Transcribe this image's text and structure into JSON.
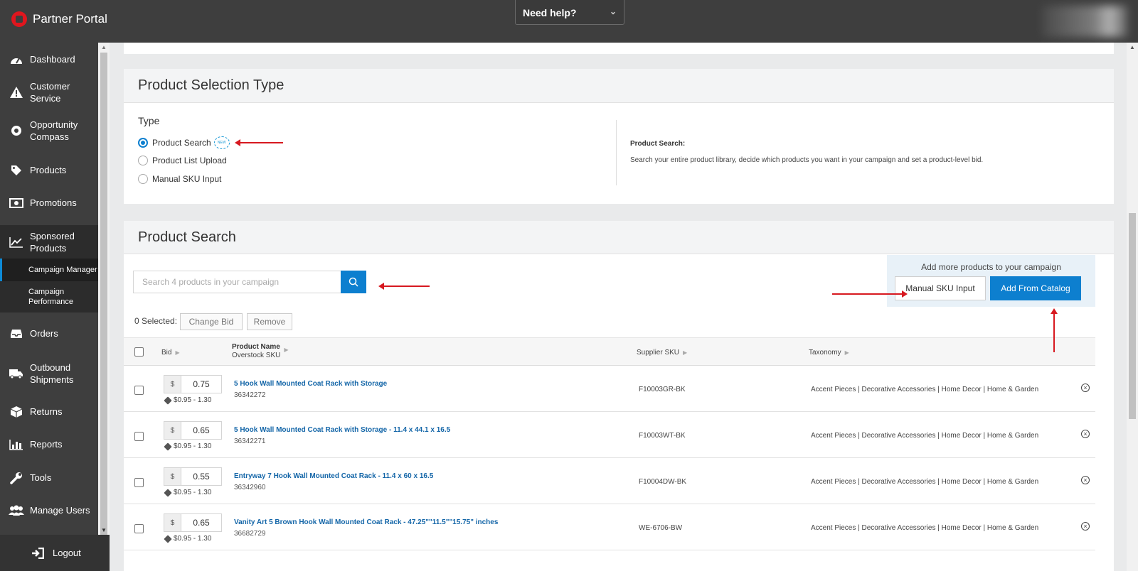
{
  "app": {
    "title": "Partner Portal",
    "help_label": "Need help?"
  },
  "sidebar": {
    "items": [
      {
        "label": "Dashboard",
        "icon": "dashboard-icon"
      },
      {
        "label": "Customer Service",
        "icon": "warning-icon"
      },
      {
        "label": "Opportunity Compass",
        "icon": "compass-icon"
      },
      {
        "label": "Products",
        "icon": "tag-icon"
      },
      {
        "label": "Promotions",
        "icon": "money-icon"
      },
      {
        "label": "Sponsored Products",
        "icon": "chart-line-icon"
      },
      {
        "label": "Orders",
        "icon": "inbox-icon"
      },
      {
        "label": "Outbound Shipments",
        "icon": "truck-icon"
      },
      {
        "label": "Returns",
        "icon": "box-icon"
      },
      {
        "label": "Reports",
        "icon": "bar-chart-icon"
      },
      {
        "label": "Tools",
        "icon": "wrench-icon"
      },
      {
        "label": "Manage Users",
        "icon": "users-icon"
      }
    ],
    "subitems": [
      {
        "label": "Campaign Manager",
        "selected": true
      },
      {
        "label": "Campaign Performance",
        "selected": false
      }
    ],
    "logout_label": "Logout"
  },
  "selection_type": {
    "title": "Product Selection Type",
    "type_label": "Type",
    "options": [
      {
        "label": "Product Search",
        "checked": true
      },
      {
        "label": "Product List Upload",
        "checked": false
      },
      {
        "label": "Manual SKU Input",
        "checked": false
      }
    ],
    "new_badge": "NEW",
    "description_title": "Product Search:",
    "description_text": "Search your entire product library, decide which products you want in your campaign and set a product-level bid."
  },
  "product_search": {
    "title": "Product Search",
    "search_placeholder": "Search 4 products in your campaign",
    "add_panel_title": "Add more products to your campaign",
    "manual_sku_button": "Manual SKU Input",
    "add_catalog_button": "Add From Catalog",
    "selected_label": "0 Selected:",
    "change_bid_button": "Change Bid",
    "remove_button": "Remove",
    "columns": {
      "bid": "Bid",
      "product_name": "Product Name",
      "overstock_sku": "Overstock SKU",
      "supplier_sku": "Supplier SKU",
      "taxonomy": "Taxonomy"
    },
    "currency": "$",
    "rows": [
      {
        "bid": "0.75",
        "range": "$0.95 - 1.30",
        "name": "5 Hook Wall Mounted Coat Rack with Storage",
        "sku": "36342272",
        "supplier_sku": "F10003GR-BK",
        "taxonomy": "Accent Pieces | Decorative Accessories | Home Decor | Home & Garden"
      },
      {
        "bid": "0.65",
        "range": "$0.95 - 1.30",
        "name": "5 Hook Wall Mounted Coat Rack with Storage - 11.4 x 44.1 x 16.5",
        "sku": "36342271",
        "supplier_sku": "F10003WT-BK",
        "taxonomy": "Accent Pieces | Decorative Accessories | Home Decor | Home & Garden"
      },
      {
        "bid": "0.55",
        "range": "$0.95 - 1.30",
        "name": "Entryway 7 Hook Wall Mounted Coat Rack - 11.4 x 60 x 16.5",
        "sku": "36342960",
        "supplier_sku": "F10004DW-BK",
        "taxonomy": "Accent Pieces | Decorative Accessories | Home Decor | Home & Garden"
      },
      {
        "bid": "0.65",
        "range": "$0.95 - 1.30",
        "name": "Vanity Art 5 Brown Hook Wall Mounted Coat Rack - 47.25\"\"11.5\"\"15.75\" inches",
        "sku": "36682729",
        "supplier_sku": "WE-6706-BW",
        "taxonomy": "Accent Pieces | Decorative Accessories | Home Decor | Home & Garden"
      }
    ]
  },
  "colors": {
    "accent": "#0d7fcf",
    "topbar": "#3e3e3e",
    "link": "#1466a8",
    "annotation": "#d71920"
  }
}
